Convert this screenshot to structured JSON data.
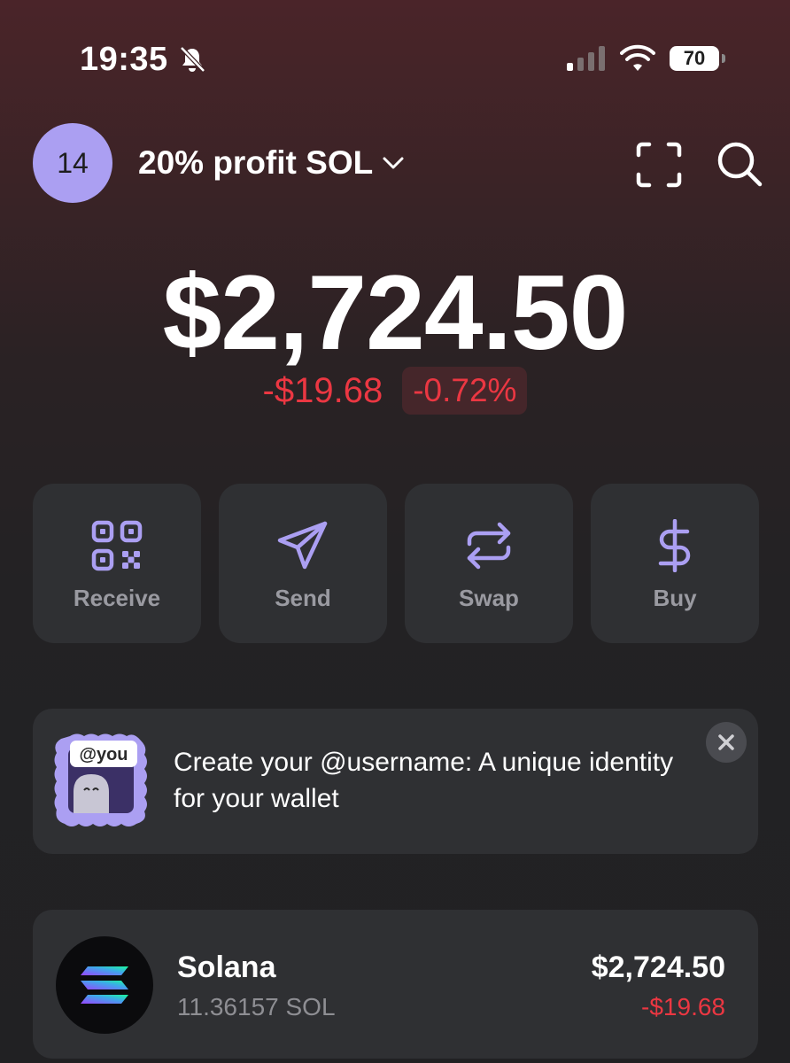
{
  "status_bar": {
    "time": "19:35",
    "battery_level": "70",
    "icons": [
      "bell-slash-icon",
      "signal-icon",
      "wifi-icon",
      "battery-icon"
    ]
  },
  "header": {
    "avatar_label": "14",
    "account_name": "20% profit SOL",
    "icons": [
      "chevron-down-icon",
      "scan-icon",
      "search-icon"
    ]
  },
  "balance": {
    "total": "$2,724.50",
    "change_amount": "-$19.68",
    "change_percent": "-0.72%"
  },
  "actions": [
    {
      "label": "Receive",
      "icon": "qr-code-icon"
    },
    {
      "label": "Send",
      "icon": "send-icon"
    },
    {
      "label": "Swap",
      "icon": "swap-icon"
    },
    {
      "label": "Buy",
      "icon": "dollar-icon"
    }
  ],
  "banner": {
    "badge": "@you",
    "text": "Create your @username: A unique identity for your wallet",
    "close_icon": "close-icon"
  },
  "tokens": [
    {
      "name": "Solana",
      "amount": "11.36157 SOL",
      "value": "$2,724.50",
      "change": "-$19.68",
      "icon": "solana-logo-icon"
    }
  ],
  "colors": {
    "accent": "#ab9ff2",
    "negative": "#eb3742",
    "card": "#2f3033",
    "text_secondary": "#8e8e93"
  }
}
